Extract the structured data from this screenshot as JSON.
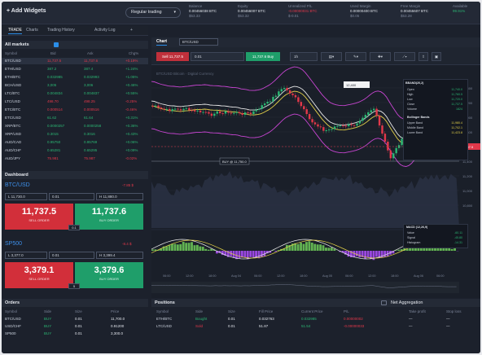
{
  "topbar": {
    "add_widgets": "+ Add Widgets",
    "mode": "Regular trading",
    "stats": [
      {
        "label": "Balance",
        "value": "0.00456038 BTC",
        "sub": "$53.33",
        "cls": "v"
      },
      {
        "label": "Equity",
        "value": "0.00456007 BTC",
        "sub": "$53.32",
        "cls": "v"
      },
      {
        "label": "Unrealized P/L",
        "value": "-0.00000031 BTC",
        "sub": "$-0.01",
        "cls": "r"
      },
      {
        "label": "Used Margin",
        "value": "0.00000400 BTC",
        "sub": "$0.05",
        "cls": "v"
      },
      {
        "label": "Free Margin",
        "value": "0.00455607 BTC",
        "sub": "$53.28",
        "cls": "v"
      },
      {
        "label": "Available",
        "value": "99.91%",
        "sub": "",
        "cls": "g"
      }
    ]
  },
  "left_tabs": [
    "TRADE",
    "Charts",
    "Trading History",
    "Activity Log",
    "+"
  ],
  "markets": {
    "title": "All markets",
    "headers": [
      "Symbol",
      "Bid",
      "Ask",
      "Chg%"
    ],
    "rows": [
      {
        "sym": "BTC/USD",
        "bid": "11,737.5",
        "ask": "11,737.6",
        "chg": "+0.19%",
        "c": "red",
        "sel": true
      },
      {
        "sym": "ETH/USD",
        "bid": "387.2",
        "ask": "387.4",
        "chg": "+1.24%",
        "c": "grn"
      },
      {
        "sym": "ETH/BTC",
        "bid": "0.032985",
        "ask": "0.032993",
        "chg": "+1.05%",
        "c": "grn"
      },
      {
        "sym": "BCH/USD",
        "bid": "3,005",
        "ask": "3,006",
        "chg": "+0.46%",
        "c": "grn"
      },
      {
        "sym": "LTC/BTC",
        "bid": "0.004834",
        "ask": "0.004837",
        "chg": "+0.55%",
        "c": "grn"
      },
      {
        "sym": "LTC/USD",
        "bid": "498.70",
        "ask": "498.25",
        "chg": "-0.25%",
        "c": "red"
      },
      {
        "sym": "ETC/BTC",
        "bid": "0.000514",
        "ask": "0.000516",
        "chg": "-0.46%",
        "c": "red"
      },
      {
        "sym": "ETC/USD",
        "bid": "61.62",
        "ask": "61.64",
        "chg": "+0.31%",
        "c": "grn"
      },
      {
        "sym": "XRP/BTC",
        "bid": "0.0000257",
        "ask": "0.0000258",
        "chg": "+0.36%",
        "c": "grn"
      },
      {
        "sym": "XRP/USD",
        "bid": "0.3015",
        "ask": "0.3016",
        "chg": "+0.43%",
        "c": "grn"
      },
      {
        "sym": "AUD/CAD",
        "bid": "0.95750",
        "ask": "0.95769",
        "chg": "+0.06%",
        "c": "grn"
      },
      {
        "sym": "AUD/CHF",
        "bid": "0.65281",
        "ask": "0.65295",
        "chg": "+0.09%",
        "c": "grn"
      },
      {
        "sym": "AUD/JPY",
        "bid": "75.981",
        "ask": "75.987",
        "chg": "-0.02%",
        "c": "red"
      }
    ]
  },
  "dashboard": {
    "title": "Dashboard",
    "cards": [
      {
        "sym": "BTC/USD",
        "chg": "-7.85 $",
        "sl": "L 11,730.0",
        "lots": "0.01",
        "tp": "H 11,880.0",
        "sell": "11,737.5",
        "buy": "11,737.6",
        "sell_label": "SELL ORDER",
        "buy_label": "BUY ORDER",
        "mid": "0.1"
      },
      {
        "sym": "SP500",
        "chg": "-8.4 $",
        "sl": "L 3,377.0",
        "lots": "0.01",
        "tp": "H 3,399.4",
        "sell": "3,379.1",
        "buy": "3,379.6",
        "sell_label": "SELL ORDER",
        "buy_label": "BUY ORDER",
        "mid": "5"
      }
    ]
  },
  "chart": {
    "tab": "Chart",
    "symbol": "BTC/USD",
    "sell_btn": "Sell 11,737.5",
    "lots": "0.01",
    "buy_btn": "11,737.6 Buy",
    "interval": "1h",
    "title_watermark": "BTC/USD Bitcoin · Digital Currency",
    "price_tag": "11,737.5",
    "alert": "BUY @ 11,750.0",
    "y_ticks": [
      "12,400",
      "12,200",
      "12,000",
      "11,800",
      "11,600",
      "11,400",
      "11,200",
      "11,000",
      "10,800"
    ],
    "x_ticks": [
      "06:00",
      "12:00",
      "18:00",
      "Aug 04",
      "06:00",
      "12:00",
      "18:00",
      "Aug 05",
      "06:00",
      "12:00",
      "18:00",
      "Aug 06",
      "06:00"
    ],
    "ohlc_box": {
      "title": "BBAND(20,2)",
      "rows": [
        [
          "Open",
          "11,740.0"
        ],
        [
          "High",
          "11,760.5"
        ],
        [
          "Low",
          "11,720.0"
        ],
        [
          "Close",
          "11,737.5"
        ],
        [
          "Volume",
          "1824"
        ]
      ],
      "bb_title": "Bollinger Bands",
      "bb_rows": [
        [
          "Upper Band",
          "11,980.4"
        ],
        [
          "Middle Band",
          "11,702.1"
        ],
        [
          "Lower Band",
          "11,423.8"
        ]
      ]
    },
    "macd": {
      "title": "MACD (12,26,9)",
      "rows": [
        [
          "Value",
          "-60.11"
        ],
        [
          "Signal",
          "-45.80"
        ],
        [
          "Histogram",
          "-14.31"
        ]
      ]
    }
  },
  "orders": {
    "title": "Orders",
    "headers": [
      "Symbol",
      "Side",
      "Size",
      "Price"
    ],
    "rows": [
      {
        "sym": "BTC/USD",
        "side": "BUY",
        "size": "0.01",
        "price": "11,700.0"
      },
      {
        "sym": "USD/CHF",
        "side": "BUY",
        "size": "0.01",
        "price": "0.91200"
      },
      {
        "sym": "SP500",
        "side": "BUY",
        "size": "0.01",
        "price": "3,300.0"
      }
    ]
  },
  "positions": {
    "title": "Positions",
    "net_label": "Net Aggregation",
    "headers": [
      "Symbol",
      "Side",
      "Size",
      "Fill Price",
      "Current Price",
      "P/L",
      "Take profit",
      "Stop loss"
    ],
    "rows": [
      {
        "sym": "ETH/BTC",
        "side": "Bought",
        "size": "0.01",
        "fill": "0.032763",
        "cur": "0.032985",
        "pl": "0.00000002",
        "tp": "—",
        "sl": "—",
        "sc": "grn"
      },
      {
        "sym": "LTC/USD",
        "side": "Sold",
        "size": "0.01",
        "fill": "51.87",
        "cur": "51.54",
        "pl": "-0.00000033",
        "tp": "—",
        "sl": "—",
        "sc": "red"
      }
    ]
  }
}
